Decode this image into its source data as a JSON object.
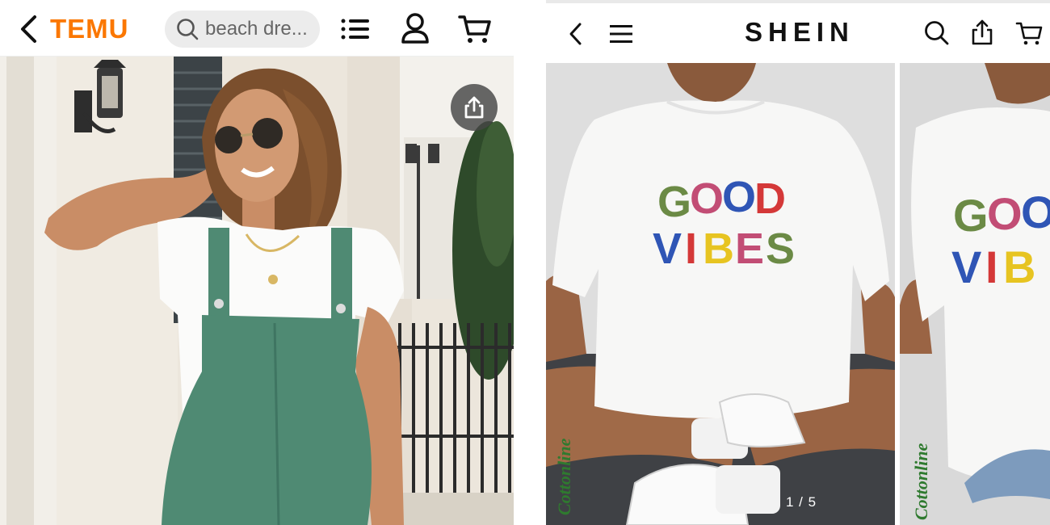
{
  "temu": {
    "brand": "TEMU",
    "search": {
      "placeholder": "beach dre..."
    },
    "icons": [
      "back-arrow-icon",
      "search-icon",
      "list-icon",
      "user-icon",
      "cart-icon",
      "share-icon"
    ],
    "product_image": "woman-green-overalls-photo"
  },
  "shein": {
    "brand": "SHEIN",
    "icons": [
      "back-arrow-icon",
      "menu-icon",
      "search-icon",
      "share-icon",
      "cart-icon"
    ],
    "slide_counter": "1 / 5",
    "shirt_text": {
      "line1": "GOOD",
      "line2": "VIBES"
    },
    "watermark": "Cottonline"
  },
  "colors": {
    "temu_accent": "#fb7701",
    "overalls_green": "#4f8a73",
    "good_vibes_letters": [
      "#6b8a45",
      "#c24d75",
      "#2f55b5",
      "#d43838",
      "#e7c421"
    ]
  }
}
